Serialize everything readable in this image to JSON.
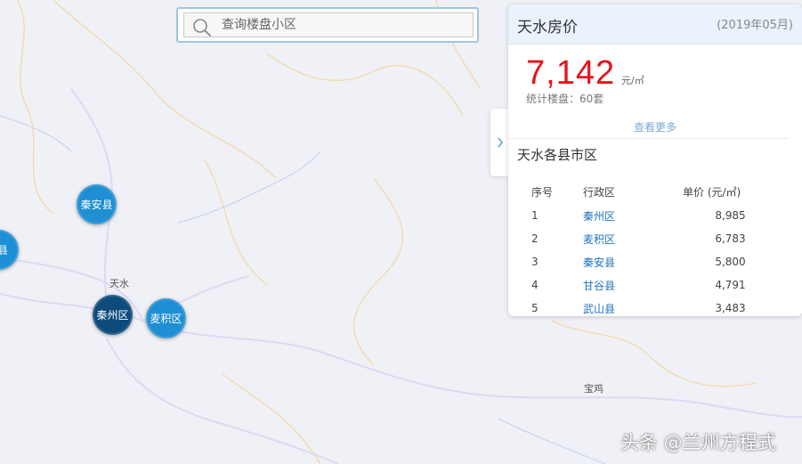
{
  "search": {
    "placeholder": "查询楼盘小区",
    "icon": "search-icon"
  },
  "map": {
    "labels": {
      "tianshui": "天水",
      "baoji": "宝鸡"
    },
    "bubbles": {
      "qinan": "秦安县",
      "qinzhou": "秦州区",
      "maiji": "麦积区",
      "edge": "县"
    },
    "colors": {
      "bubble": "#1e8fd4",
      "bubble_active": "#0d4b7c"
    }
  },
  "panel": {
    "title": "天水房价",
    "date": "(2019年05月)",
    "price": "7,142",
    "price_unit": "元/㎡",
    "stats": "统计楼盘：60套",
    "more": "查看更多",
    "collapse_icon": "chevron-right-icon",
    "sub_title": "天水各县市区",
    "table": {
      "headers": [
        "序号",
        "行政区",
        "单价 (元/㎡)"
      ],
      "rows": [
        [
          "1",
          "秦州区",
          "8,985"
        ],
        [
          "2",
          "麦积区",
          "6,783"
        ],
        [
          "3",
          "秦安县",
          "5,800"
        ],
        [
          "4",
          "甘谷县",
          "4,791"
        ],
        [
          "5",
          "武山县",
          "3,483"
        ]
      ]
    },
    "colors": {
      "price": "#e8121a",
      "link": "#1c72b8",
      "header_bg": "#eaf2fb"
    }
  },
  "watermark": "头条 @兰州方程式"
}
